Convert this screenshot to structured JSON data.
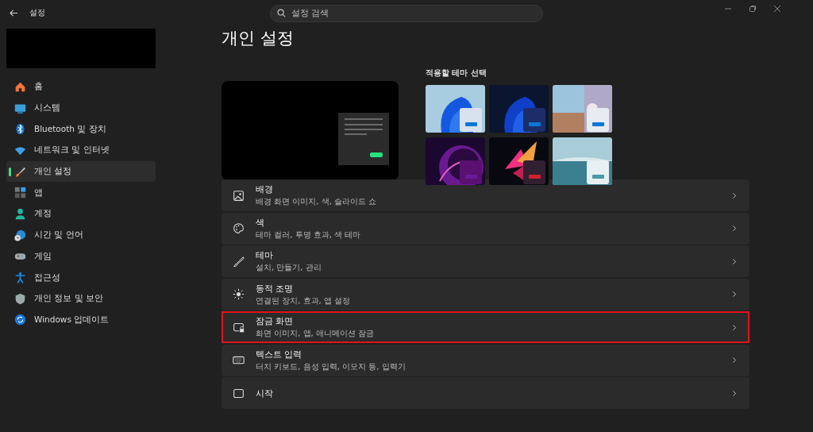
{
  "window": {
    "title": "설정"
  },
  "search": {
    "placeholder": "설정 검색"
  },
  "sidebar": {
    "items": [
      {
        "label": "홈",
        "selected": false
      },
      {
        "label": "시스템",
        "selected": false
      },
      {
        "label": "Bluetooth 및 장치",
        "selected": false
      },
      {
        "label": "네트워크 및 인터넷",
        "selected": false
      },
      {
        "label": "개인 설정",
        "selected": true
      },
      {
        "label": "앱",
        "selected": false
      },
      {
        "label": "계정",
        "selected": false
      },
      {
        "label": "시간 및 언어",
        "selected": false
      },
      {
        "label": "게임",
        "selected": false
      },
      {
        "label": "접근성",
        "selected": false
      },
      {
        "label": "개인 정보 및 보안",
        "selected": false
      },
      {
        "label": "Windows 업데이트",
        "selected": false
      }
    ]
  },
  "page_title": "개인 설정",
  "themes": {
    "heading": "적용할 테마 선택"
  },
  "settings": [
    {
      "title": "배경",
      "subtitle": "배경 화면 이미지, 색, 슬라이드 쇼",
      "highlighted": false
    },
    {
      "title": "색",
      "subtitle": "테마 컬러, 투명 효과, 색 테마",
      "highlighted": false
    },
    {
      "title": "테마",
      "subtitle": "설치, 만들기, 관리",
      "highlighted": false
    },
    {
      "title": "동적 조명",
      "subtitle": "연결된 장치, 효과, 앱 설정",
      "highlighted": false
    },
    {
      "title": "잠금 화면",
      "subtitle": "화면 이미지, 앱, 애니메이션 잠금",
      "highlighted": true
    },
    {
      "title": "텍스트 입력",
      "subtitle": "터치 키보드, 음성 입력, 이모지 등, 입력기",
      "highlighted": false
    },
    {
      "title": "시작",
      "highlighted": false
    }
  ]
}
